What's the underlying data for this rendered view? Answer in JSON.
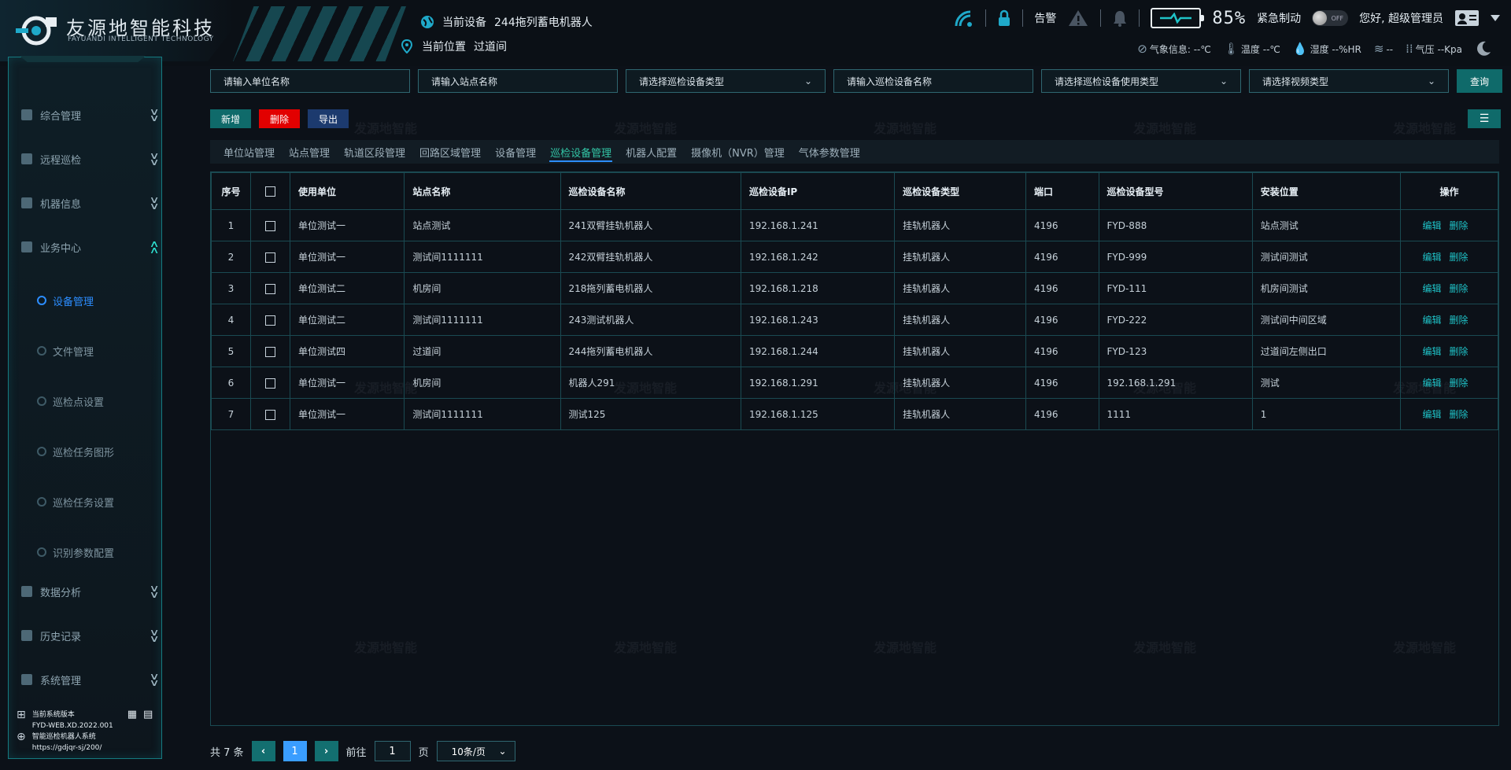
{
  "brand": {
    "name_cn": "友源地智能科技",
    "name_en": "FAYUANDI INTELLIGENT TECHNOLOGY"
  },
  "header": {
    "device_label": "当前设备",
    "device_value": "244拖列蓄电机器人",
    "location_label": "当前位置",
    "location_value": "过道间",
    "alarm_label": "告警",
    "battery_pct": "85%",
    "estop_label": "紧急制动",
    "toggle_state": "OFF",
    "greeting": "您好,  超级管理员"
  },
  "weather": {
    "label": "气象信息:",
    "temp_value": "--℃",
    "temp_label": "温度",
    "humid_label": "湿度",
    "humid_value": "--%HR",
    "wind_value": "--",
    "press_label": "气压",
    "press_value": "--Kpa",
    "temp_prefix": "温度 --℃"
  },
  "watermark": "发源地智能",
  "sidebar": {
    "items": [
      {
        "label": "综合管理"
      },
      {
        "label": "远程巡检"
      },
      {
        "label": "机器信息"
      },
      {
        "label": "业务中心"
      },
      {
        "label": "数据分析"
      },
      {
        "label": "历史记录"
      },
      {
        "label": "系统管理"
      }
    ],
    "subitems": [
      {
        "label": "设备管理"
      },
      {
        "label": "文件管理"
      },
      {
        "label": "巡检点设置"
      },
      {
        "label": "巡检任务图形"
      },
      {
        "label": "巡检任务设置"
      },
      {
        "label": "识别参数配置"
      }
    ],
    "version": {
      "label": "当前系统版本",
      "value": "FYD-WEB.XD.2022.001",
      "system": "智能巡检机器人系统",
      "url": "https://gdjqr-sj/200/"
    }
  },
  "filters": {
    "unit": "请输入单位名称",
    "station": "请输入站点名称",
    "device_type": "请选择巡检设备类型",
    "device_name": "请输入巡检设备名称",
    "usage_type": "请选择巡检设备使用类型",
    "video_type": "请选择视频类型",
    "query": "查询"
  },
  "actions": {
    "add": "新增",
    "delete": "删除",
    "export": "导出",
    "columns": "☰"
  },
  "tabs": [
    {
      "label": "单位站管理"
    },
    {
      "label": "站点管理"
    },
    {
      "label": "轨道区段管理"
    },
    {
      "label": "回路区域管理"
    },
    {
      "label": "设备管理"
    },
    {
      "label": "巡检设备管理"
    },
    {
      "label": "机器人配置"
    },
    {
      "label": "摄像机（NVR）管理"
    },
    {
      "label": "气体参数管理"
    }
  ],
  "table": {
    "headers": [
      "序号",
      "使用单位",
      "站点名称",
      "巡检设备名称",
      "巡检设备IP",
      "巡检设备类型",
      "端口",
      "巡检设备型号",
      "安装位置",
      "操作"
    ],
    "rows": [
      [
        "1",
        "单位测试一",
        "站点测试",
        "241双臂挂轨机器人",
        "192.168.1.241",
        "挂轨机器人",
        "4196",
        "FYD-888",
        "站点测试",
        ""
      ],
      [
        "2",
        "单位测试一",
        "测试间1111111",
        "242双臂挂轨机器人",
        "192.168.1.242",
        "挂轨机器人",
        "4196",
        "FYD-999",
        "测试间测试",
        ""
      ],
      [
        "3",
        "单位测试二",
        "机房间",
        "218拖列蓄电机器人",
        "192.168.1.218",
        "挂轨机器人",
        "4196",
        "FYD-111",
        "机房间测试",
        ""
      ],
      [
        "4",
        "单位测试二",
        "测试间1111111",
        "243测试机器人",
        "192.168.1.243",
        "挂轨机器人",
        "4196",
        "FYD-222",
        "测试间中间区域",
        ""
      ],
      [
        "5",
        "单位测试四",
        "过道间",
        "244拖列蓄电机器人",
        "192.168.1.244",
        "挂轨机器人",
        "4196",
        "FYD-123",
        "过道间左侧出口",
        ""
      ],
      [
        "6",
        "单位测试一",
        "机房间",
        "机器人291",
        "192.168.1.291",
        "挂轨机器人",
        "4196",
        "192.168.1.291",
        "测试",
        ""
      ],
      [
        "7",
        "单位测试一",
        "测试间1111111",
        "测试125",
        "192.168.1.125",
        "挂轨机器人",
        "4196",
        "1111",
        "1",
        ""
      ]
    ],
    "edit_label": "编辑",
    "delete_label": "删除"
  },
  "pager": {
    "total": "共 7 条",
    "current": "1",
    "goto_label": "前往",
    "goto_value": "1",
    "page_unit": "页",
    "page_size": "10条/页"
  }
}
